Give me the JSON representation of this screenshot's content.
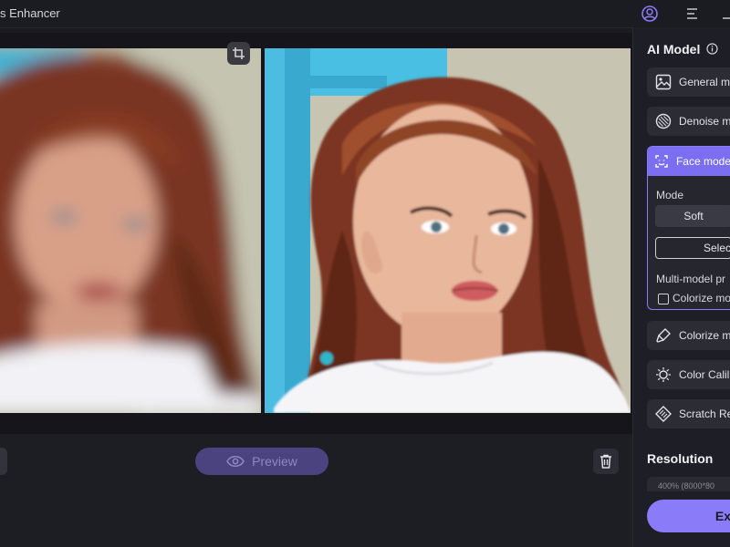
{
  "app": {
    "title": "s Enhancer"
  },
  "canvas": {
    "preview_label": "Preview"
  },
  "sidebar": {
    "ai_model_heading": "AI Model",
    "models": [
      {
        "label": "General m",
        "icon": "image-icon"
      },
      {
        "label": "Denoise m",
        "icon": "denoise-icon"
      },
      {
        "label": "Colorize m",
        "icon": "colorize-icon"
      },
      {
        "label": "Color Calil",
        "icon": "brightness-icon"
      },
      {
        "label": "Scratch Re",
        "icon": "scratch-icon"
      }
    ],
    "face_model": {
      "label": "Face mode",
      "mode_label": "Mode",
      "mode_value": "Soft",
      "select_label": "Selec",
      "multi_model_label": "Multi-model pr",
      "colorize_checkbox_label": "Colorize mo",
      "colorize_checked": false
    },
    "resolution_heading": "Resolution",
    "resolution_value": "400% (8000*80",
    "export_label": "Ex"
  },
  "colors": {
    "accent": "#8a7cf6",
    "accent_active": "#7b6ef0",
    "background": "#1b1b22"
  }
}
